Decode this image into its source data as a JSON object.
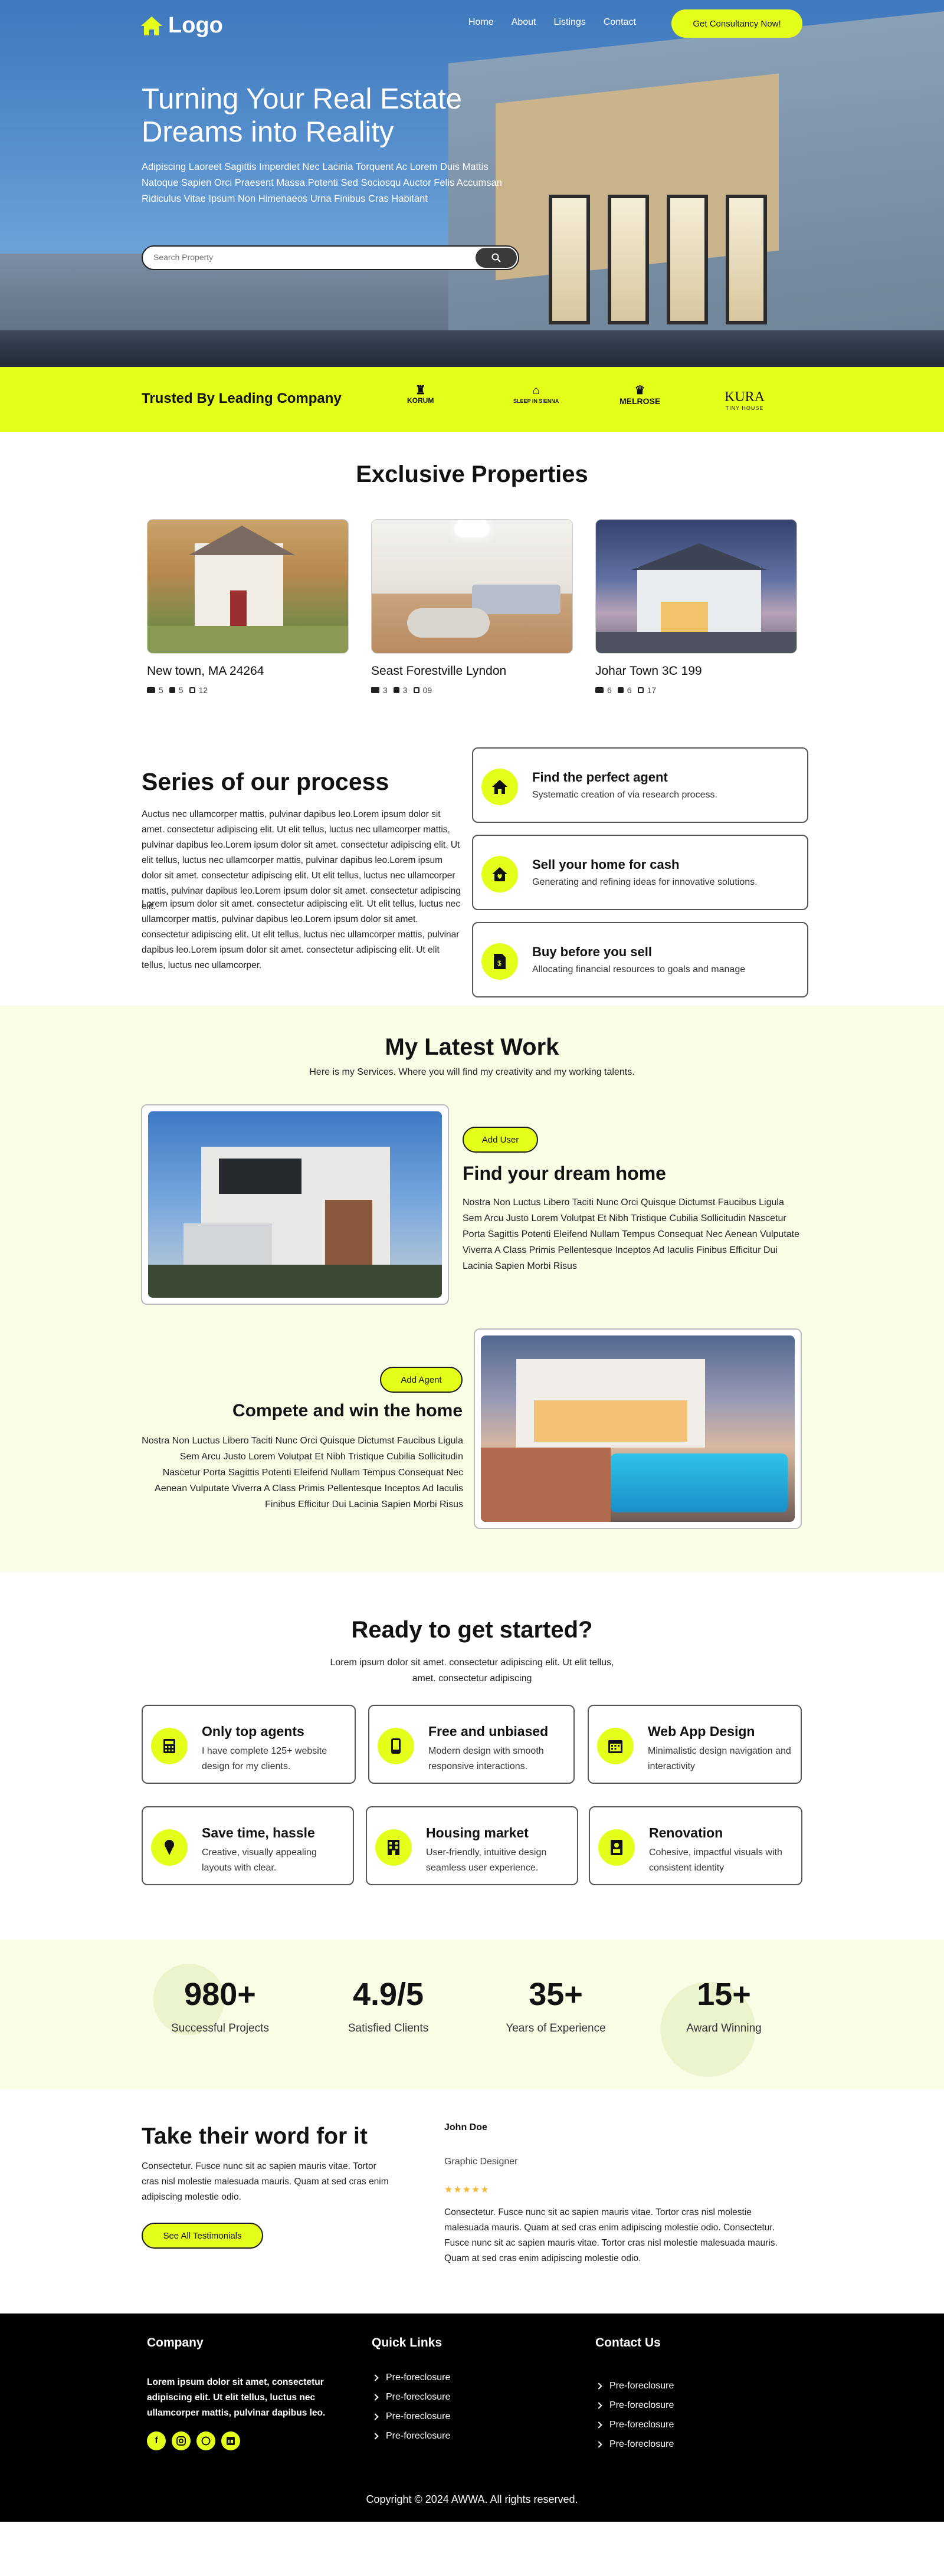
{
  "nav": {
    "logo": "Logo",
    "links": [
      "Home",
      "About",
      "Listings",
      "Contact"
    ],
    "cta": "Get Consultancy Now!"
  },
  "hero": {
    "title": "Turning Your Real Estate Dreams into Reality",
    "description": "Adipiscing Laoreet Sagittis Imperdiet Nec Lacinia Torquent Ac Lorem Duis Mattis Natoque Sapien Orci Praesent Massa Potenti Sed Sociosqu Auctor Felis Accumsan Ridiculus Vitae Ipsum Non Himenaeos Urna Finibus Cras Habitant",
    "search_placeholder": "Search Property"
  },
  "trusted": {
    "title": "Trusted By Leading Company",
    "brands": [
      {
        "name": "KORUM",
        "tag": ""
      },
      {
        "name": "SLEEP IN SIENNA",
        "tag": ""
      },
      {
        "name": "MELROSE",
        "tag": ""
      },
      {
        "name": "KURA",
        "tag": "TINY HOUSE"
      }
    ]
  },
  "exclusive": {
    "title": "Exclusive Properties",
    "items": [
      {
        "title": "New town, MA 24264",
        "beds": "5",
        "baths": "5",
        "area": "12"
      },
      {
        "title": "Seast Forestville Lyndon",
        "beds": "3",
        "baths": "3",
        "area": "09"
      },
      {
        "title": "Johar Town 3C 199",
        "beds": "6",
        "baths": "6",
        "area": "17"
      }
    ]
  },
  "process": {
    "title": "Series of our process",
    "para1": "Auctus nec ullamcorper mattis, pulvinar dapibus leo.Lorem ipsum dolor sit amet. consectetur adipiscing elit. Ut elit tellus, luctus nec ullamcorper mattis, pulvinar dapibus leo.Lorem ipsum dolor sit amet. consectetur adipiscing elit. Ut elit tellus, luctus nec ullamcorper mattis, pulvinar dapibus leo.Lorem ipsum dolor sit amet. consectetur adipiscing elit. Ut elit tellus, luctus nec ullamcorper mattis, pulvinar dapibus leo.Lorem ipsum dolor sit amet. consectetur adipiscing elit.",
    "para2": "Lorem ipsum dolor sit amet. consectetur adipiscing elit. Ut elit tellus, luctus nec ullamcorper mattis, pulvinar dapibus leo.Lorem ipsum dolor sit amet. consectetur adipiscing elit. Ut elit tellus, luctus nec ullamcorper mattis, pulvinar dapibus leo.Lorem ipsum dolor sit amet. consectetur adipiscing elit. Ut elit tellus, luctus nec ullamcorper.",
    "cards": [
      {
        "icon": "home-icon",
        "title": "Find the perfect agent",
        "desc": "Systematic creation of via research process."
      },
      {
        "icon": "house-heart-icon",
        "title": "Sell your home for cash",
        "desc": "Generating and refining ideas for innovative solutions."
      },
      {
        "icon": "document-icon",
        "title": "Buy before you sell",
        "desc": "Allocating financial resources to goals and manage"
      }
    ]
  },
  "latest": {
    "title": "My Latest Work",
    "subtitle": "Here is my Services. Where you will find my creativity and my working talents.",
    "work1": {
      "button": "Add User",
      "title": "Find your dream home",
      "desc": "Nostra Non Luctus Libero Taciti Nunc Orci Quisque Dictumst Faucibus Ligula Sem Arcu Justo Lorem Volutpat Et Nibh Tristique Cubilia Sollicitudin Nascetur Porta Sagittis Potenti Eleifend Nullam Tempus Consequat Nec Aenean Vulputate Viverra A Class Primis Pellentesque Inceptos Ad Iaculis Finibus Efficitur Dui Lacinia Sapien Morbi Risus"
    },
    "work2": {
      "button": "Add Agent",
      "title": "Compete and win the home",
      "desc": "Nostra Non Luctus Libero Taciti Nunc Orci Quisque Dictumst Faucibus Ligula Sem Arcu Justo Lorem Volutpat Et Nibh Tristique Cubilia Sollicitudin Nascetur Porta Sagittis Potenti Eleifend Nullam Tempus Consequat Nec Aenean Vulputate Viverra A Class Primis Pellentesque Inceptos Ad Iaculis Finibus Efficitur Dui Lacinia Sapien Morbi Risus"
    }
  },
  "ready": {
    "title": "Ready to get started?",
    "subtitle": "Lorem ipsum dolor sit amet. consectetur adipiscing elit. Ut elit tellus, amet. consectetur adipiscing",
    "cards": [
      {
        "icon": "calculator-icon",
        "title": "Only top agents",
        "desc": "I have complete 125+ website design for my clients."
      },
      {
        "icon": "phone-icon",
        "title": "Free and unbiased",
        "desc": "Modern design with smooth responsive interactions."
      },
      {
        "icon": "calendar-icon",
        "title": "Web App Design",
        "desc": "Minimalistic design navigation and interactivity"
      },
      {
        "icon": "ice-cream-icon",
        "title": "Save time, hassle",
        "desc": "Creative, visually appealing layouts with clear."
      },
      {
        "icon": "building-icon",
        "title": "Housing market",
        "desc": "User-friendly, intuitive design seamless user experience."
      },
      {
        "icon": "id-card-icon",
        "title": "Renovation",
        "desc": "Cohesive, impactful visuals with consistent identity"
      }
    ]
  },
  "stats": [
    {
      "value": "980+",
      "label": "Successful Projects"
    },
    {
      "value": "4.9/5",
      "label": "Satisfied Clients"
    },
    {
      "value": "35+",
      "label": "Years of Experience"
    },
    {
      "value": "15+",
      "label": "Award Winning"
    }
  ],
  "testimonial": {
    "title": "Take their word for it",
    "desc": "Consectetur. Fusce nunc sit ac sapien mauris vitae. Tortor cras nisl molestie malesuada mauris. Quam at sed cras enim adipiscing molestie odio.",
    "button": "See All Testimonials",
    "name": "John Doe",
    "role": "Graphic Designer",
    "stars": "★★★★★",
    "quote": "Consectetur. Fusce nunc sit ac sapien mauris vitae. Tortor cras nisl molestie malesuada mauris. Quam at sed cras enim adipiscing molestie odio. Consectetur. Fusce nunc sit ac sapien mauris vitae. Tortor cras nisl molestie malesuada mauris. Quam at sed cras enim adipiscing molestie odio."
  },
  "footer": {
    "company_title": "Company",
    "company_desc": "Lorem ipsum dolor sit amet, consectetur adipiscing elit. Ut elit tellus, luctus nec ullamcorper mattis, pulvinar dapibus leo.",
    "social": [
      "facebook-icon",
      "instagram-icon",
      "dribbble-icon",
      "linkedin-icon"
    ],
    "quick_title": "Quick Links",
    "quick_links": [
      "Pre-foreclosure",
      "Pre-foreclosure",
      "Pre-foreclosure",
      "Pre-foreclosure"
    ],
    "contact_title": "Contact Us",
    "contact_links": [
      "Pre-foreclosure",
      "Pre-foreclosure",
      "Pre-foreclosure",
      "Pre-foreclosure"
    ],
    "copyright": "Copyright © 2024 AWWA. All rights reserved."
  },
  "colors": {
    "accent": "#e4ff1a",
    "footer_bg": "#000000",
    "soft_bg": "#f8fde6"
  }
}
